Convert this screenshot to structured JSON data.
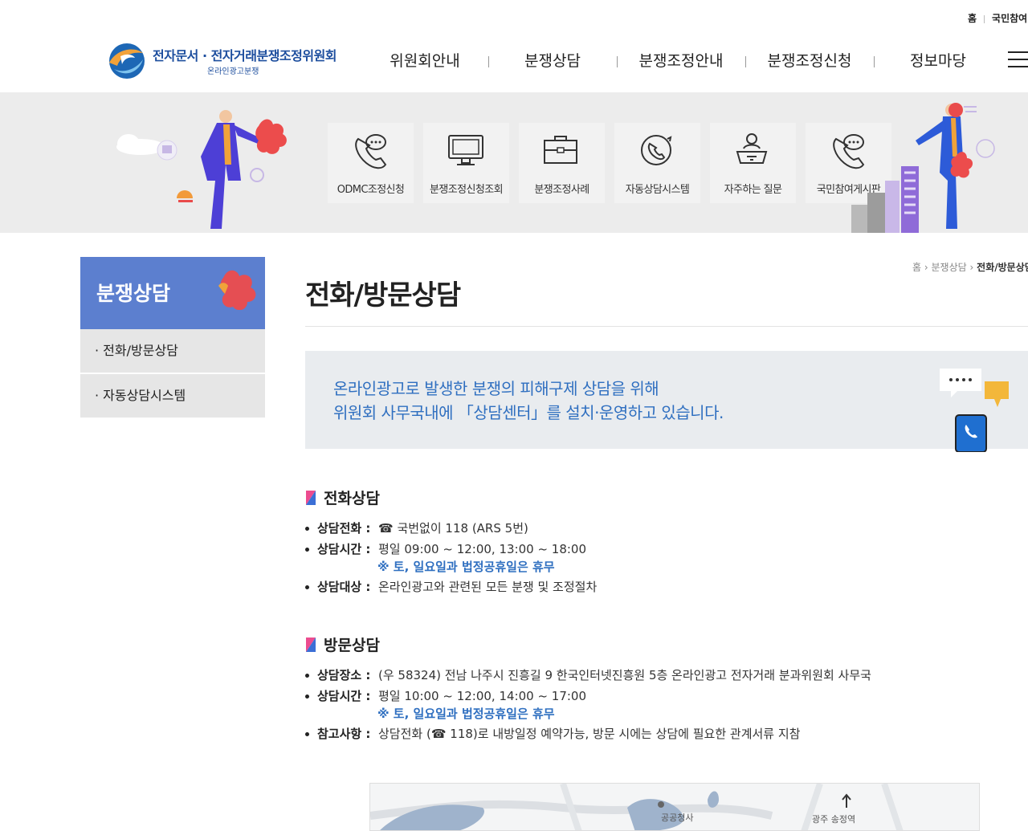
{
  "utility": {
    "home": "홈",
    "participation": "국민참여"
  },
  "logo": {
    "title": "전자문서 · 전자거래분쟁조정위원회",
    "subtitle": "온라인광고분쟁"
  },
  "gnb": [
    "위원회안내",
    "분쟁상담",
    "분쟁조정안내",
    "분쟁조정신청",
    "정보마당"
  ],
  "quick_menu": [
    {
      "label": "ODMC조정신청",
      "icon": "phone-chat-icon"
    },
    {
      "label": "분쟁조정신청조회",
      "icon": "monitor-icon"
    },
    {
      "label": "분쟁조정사례",
      "icon": "briefcase-icon"
    },
    {
      "label": "자동상담시스템",
      "icon": "phone-cycle-icon"
    },
    {
      "label": "자주하는 질문",
      "icon": "question-person-icon"
    },
    {
      "label": "국민참여게시판",
      "icon": "phone-chat-icon"
    }
  ],
  "lnb": {
    "title": "분쟁상담",
    "items": [
      "· 전화/방문상담",
      "· 자동상담시스템"
    ]
  },
  "breadcrumb": {
    "home": "홈",
    "sep": "›",
    "level1": "분쟁상담",
    "current": "전화/방문상담"
  },
  "page_title": "전화/방문상담",
  "intro": {
    "line1": "온라인광고로 발생한 분쟁의 피해구제 상담을 위해",
    "line2": "위원회 사무국내에 「상담센터」를 설치·운영하고 있습니다."
  },
  "phone": {
    "title": "전화상담",
    "rows": [
      {
        "key": "상담전화 :",
        "value": "☎ 국번없이 118 (ARS 5번)"
      },
      {
        "key": "상담시간 :",
        "value": "평일 09:00 ~ 12:00, 13:00 ~ 18:00"
      },
      {
        "key": "상담대상 :",
        "value": "온라인광고와 관련된 모든 분쟁 및 조정절차"
      }
    ],
    "note": "※ 토, 일요일과 법정공휴일은 휴무"
  },
  "visit": {
    "title": "방문상담",
    "rows": [
      {
        "key": "상담장소 :",
        "value": "(우 58324) 전남 나주시 진흥길 9 한국인터넷진흥원 5층 온라인광고 전자거래 분과위원회 사무국"
      },
      {
        "key": "상담시간 :",
        "value": "평일 10:00 ~ 12:00, 14:00 ~ 17:00"
      },
      {
        "key": "참고사항 :",
        "value": "상담전화 (☎ 118)로 내방일정 예약가능, 방문 시에는 상담에 필요한 관계서류 지참"
      }
    ],
    "note": "※ 토, 일요일과 법정공휴일은 휴무"
  },
  "map": {
    "label1": "공공청사",
    "label2": "광주 송정역"
  },
  "colors": {
    "brand": "#1d4e9e",
    "lnb": "#5c7fcf",
    "accent": "#2f6fc0"
  }
}
